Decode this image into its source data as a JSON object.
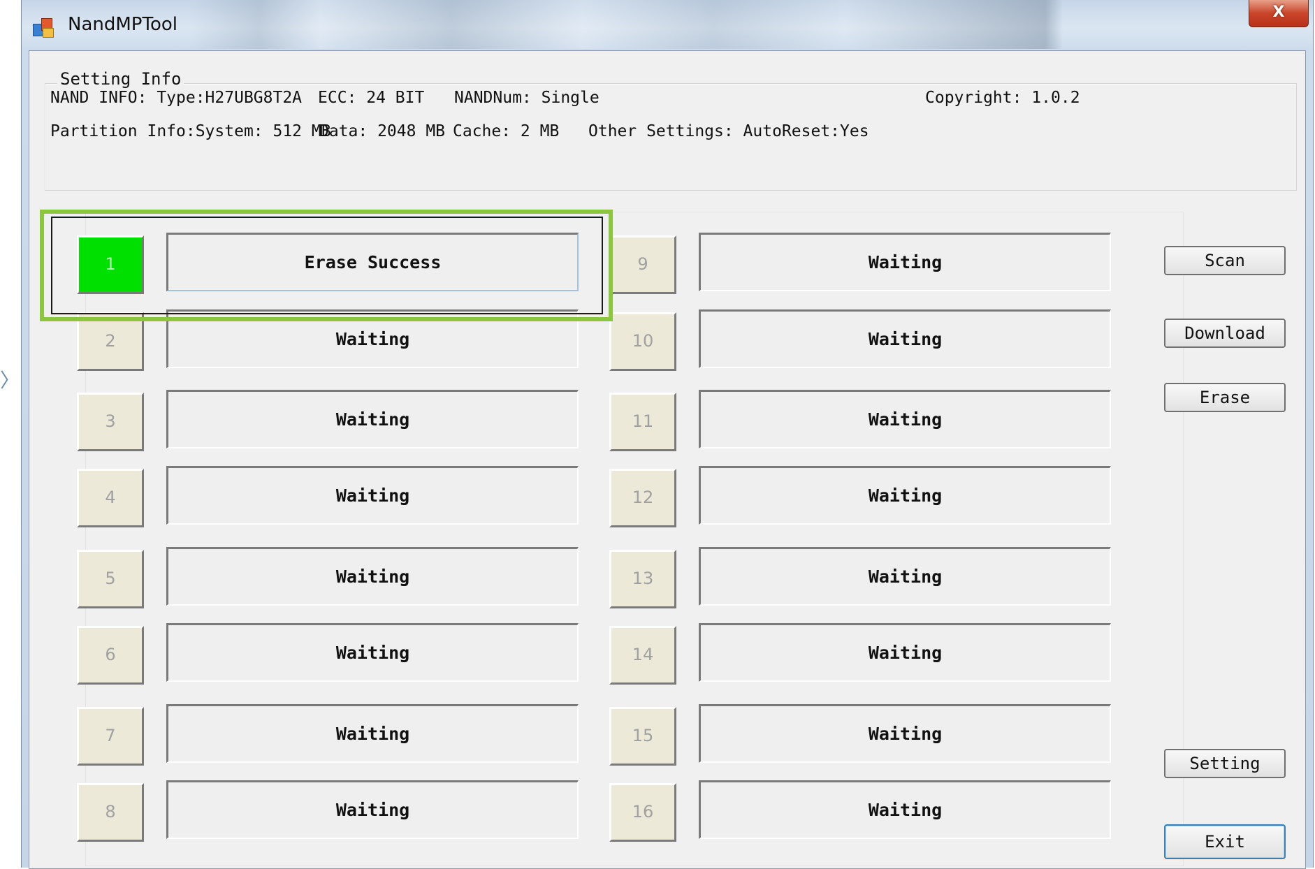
{
  "window": {
    "title": "NandMPTool",
    "close_label": "X"
  },
  "setting_info": {
    "legend": "Setting Info",
    "nand_info": "NAND INFO: Type:H27UBG8T2A",
    "ecc": "ECC: 24 BIT",
    "nand_num": "NANDNum: Single",
    "copyright": "Copyright: 1.0.2",
    "partition": "Partition Info:System: 512 MB",
    "data": "Data: 2048 MB",
    "cache": "Cache: 2 MB",
    "other": "Other Settings: AutoReset:Yes"
  },
  "ports": [
    {
      "num": "1",
      "status": "Erase Success",
      "ok": true
    },
    {
      "num": "2",
      "status": "Waiting"
    },
    {
      "num": "3",
      "status": "Waiting"
    },
    {
      "num": "4",
      "status": "Waiting"
    },
    {
      "num": "5",
      "status": "Waiting"
    },
    {
      "num": "6",
      "status": "Waiting"
    },
    {
      "num": "7",
      "status": "Waiting"
    },
    {
      "num": "8",
      "status": "Waiting"
    },
    {
      "num": "9",
      "status": "Waiting"
    },
    {
      "num": "10",
      "status": "Waiting"
    },
    {
      "num": "11",
      "status": "Waiting"
    },
    {
      "num": "12",
      "status": "Waiting"
    },
    {
      "num": "13",
      "status": "Waiting"
    },
    {
      "num": "14",
      "status": "Waiting"
    },
    {
      "num": "15",
      "status": "Waiting"
    },
    {
      "num": "16",
      "status": "Waiting"
    }
  ],
  "buttons": {
    "scan": "Scan",
    "download": "Download",
    "erase": "Erase",
    "setting": "Setting",
    "exit": "Exit"
  },
  "colors": {
    "success": "#00e000",
    "highlight": "#8cc63f"
  }
}
